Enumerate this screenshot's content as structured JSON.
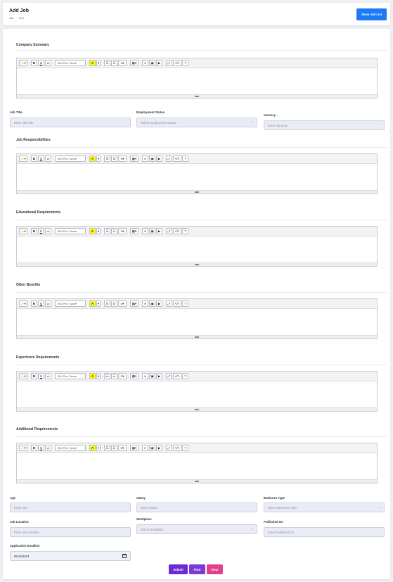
{
  "header": {
    "title": "Add Job",
    "breadcrumb": [
      "Job",
      "Add"
    ],
    "show_list_label": "Show Job List"
  },
  "editor_toolbar": {
    "magic": "✨▾",
    "bold": "B",
    "underline": "U",
    "eraser": "⌀",
    "font_family": "IBM Plex Sans",
    "highlight": "A",
    "color_caret": "▾",
    "ul": "☰",
    "ol": "☱",
    "paragraph": "≡▾",
    "table": "▦▾",
    "link": "∞",
    "picture": "▣",
    "video": "▶",
    "fullscreen": "⤢",
    "code": "</>",
    "help": "?"
  },
  "sections": {
    "company_summary": "Company Summary",
    "job_responsibilities": "Job Responsibilities",
    "educational_requirements": "Educational Requirements",
    "other_benefits": "Other Benefits",
    "experience_requirements": "Experience Requirements",
    "additional_requirements": "Additional Requirements"
  },
  "fields": {
    "job_title": {
      "label": "Job Title",
      "placeholder": "Enter Job Title"
    },
    "employment_status": {
      "label": "Employment Status",
      "placeholder": "Select Employment Status"
    },
    "vacancy": {
      "label": "Vacancy",
      "placeholder": "Enter Vacancy"
    },
    "age": {
      "label": "Age",
      "placeholder": "Enter Age"
    },
    "salary": {
      "label": "Salary",
      "placeholder": "Enter Salary"
    },
    "business_type": {
      "label": "Business Type",
      "placeholder": "Select Business Type"
    },
    "job_location": {
      "label": "Job Location",
      "placeholder": "Enter Job Location"
    },
    "workplace": {
      "label": "Workplace",
      "placeholder": "Select workplace"
    },
    "published_on": {
      "label": "Published On",
      "placeholder": "Enter Published On"
    },
    "application_deadline": {
      "label": "Application Deadline",
      "value": "08/19/2024"
    }
  },
  "actions": {
    "submit": "Submit",
    "print": "Print",
    "clear": "Clear"
  },
  "colors": {
    "primary_blue": "#1d7bf5",
    "submit": "#6a2ad4",
    "print": "#7c3ad6",
    "clear": "#e2408c"
  }
}
